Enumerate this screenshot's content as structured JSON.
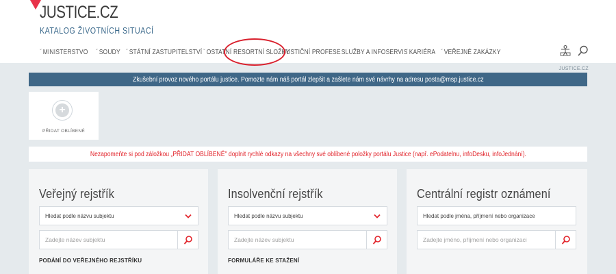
{
  "brand": {
    "logo_text": "JUSTICE.CZ",
    "subtitle": "KATALOG ŽIVOTNÍCH SITUACÍ",
    "logo_color": "#e8334a"
  },
  "nav": {
    "items": [
      {
        "label": "MINISTERSTVO"
      },
      {
        "label": "SOUDY"
      },
      {
        "label": "STÁTNÍ ZASTUPITELSTVÍ"
      },
      {
        "label": "OSTATNÍ RESORTNÍ SLOŽKY"
      },
      {
        "label": "JUSTIČNÍ PROFESE"
      },
      {
        "label": "SLUŽBY A INFOSERVIS"
      },
      {
        "label": "KARIÉRA"
      },
      {
        "label": "VEŘEJNÉ ZAKÁZKY"
      }
    ],
    "highlight_color": "#d9202d"
  },
  "top_icons": [
    "accessibility-icon",
    "search-icon"
  ],
  "site_label": "JUSTICE.CZ",
  "banner": {
    "text": "Zkušební provoz nového portálu justice. Pomozte nám náš portál zlepšit a zašlete nám své návrhy na adresu posta@msp.justice.cz",
    "color": "#3f6787"
  },
  "favorites": {
    "label": "PŘIDAT OBLÍBENÉ",
    "icon": "plus-icon"
  },
  "notice": {
    "text": "Nezapomeňte si pod záložkou „PŘIDAT OBLÍBENÉ\" doplnit rychlé odkazy na všechny své oblíbené položky portálu Justice (např. ePodatelnu, infoDesku, infoJednání).",
    "color": "#e2252c"
  },
  "panels": [
    {
      "title": "Veřejný rejstřík",
      "select_value": "Hledat podle názvu subjektu",
      "input_placeholder": "Zadejte název subjektu",
      "link": "PODÁNÍ DO VEŘEJNÉHO REJSTŘÍKU",
      "has_select_arrow": true
    },
    {
      "title": "Insolvenční rejstřík",
      "select_value": "Hledat podle názvu subjektu",
      "input_placeholder": "Zadejte název subjektu",
      "link": "FORMULÁŘE KE STAŽENÍ",
      "has_select_arrow": true
    },
    {
      "title": "Centrální registr oznámení",
      "select_value": "Hledat podle jména, příjmení nebo organizace",
      "input_placeholder": "Zadejte jméno, příjmení nebo organizaci",
      "link": "",
      "has_select_arrow": false
    }
  ]
}
